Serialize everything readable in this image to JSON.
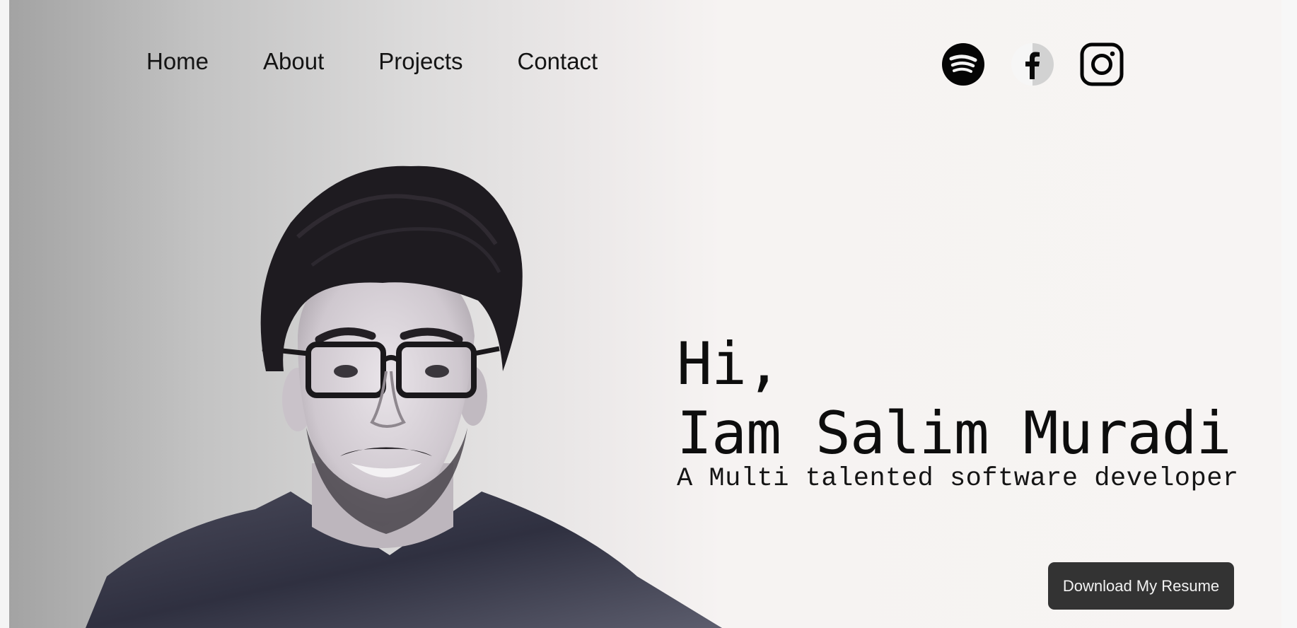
{
  "nav": {
    "items": [
      "Home",
      "About",
      "Projects",
      "Contact"
    ]
  },
  "social": {
    "icons": [
      "spotify-icon",
      "facebook-icon",
      "instagram-icon"
    ]
  },
  "hero": {
    "greeting": "Hi,",
    "name_line": "Iam Salim Muradi",
    "tagline": "A Multi talented software developer",
    "button_label": "Download My Resume"
  },
  "colors": {
    "text": "#141414",
    "button_bg": "#333333",
    "button_text": "#f2f2f2",
    "background_left": "#a3a3a3",
    "background_right": "#f7f4f3"
  }
}
